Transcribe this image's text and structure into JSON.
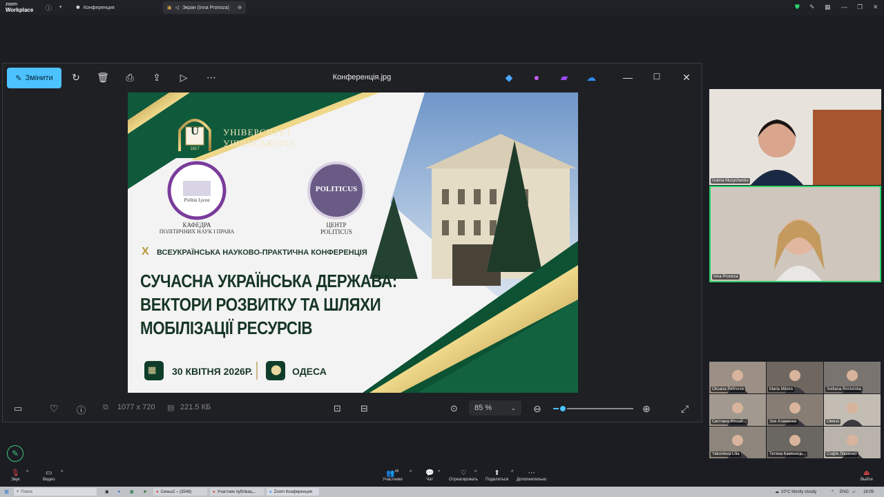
{
  "zoom": {
    "logo_line1": "zoom",
    "logo_line2": "Workplace",
    "tabs": [
      {
        "label": "Конференция"
      },
      {
        "label": "Экран (Inna Pronoza)"
      }
    ]
  },
  "photos": {
    "edit_label": "Змінити",
    "file_name": "Конференція.jpg",
    "dimensions": "1077 x 720",
    "file_size": "221.5 КБ",
    "zoom_level": "85 %",
    "zoom_fraction": 0.12
  },
  "slide": {
    "university_line1": "УНІВЕРСИТЕТ",
    "university_line2": "УШИНСЬКОГО",
    "logo_year": "1817",
    "logo_letter": "U",
    "dept_line1": "КАФЕДРА",
    "dept_line2": "ПОЛІТИЧНИХ НАУК І ПРАВА",
    "dept_logo_text": "Politia Lycea",
    "center_logo_text": "POLITICUS",
    "center_line1": "ЦЕНТР",
    "center_line2": "POLITICUS",
    "conf_number": "X",
    "conf_subtitle": "ВСЕУКРАЇНСЬКА НАУКОВО-ПРАКТИЧНА КОНФЕРЕНЦІЯ",
    "title_line1": "СУЧАСНА УКРАЇНСЬКА ДЕРЖАВА:",
    "title_line2": "ВЕКТОРИ РОЗВИТКУ ТА ШЛЯХИ",
    "title_line3": "МОБІЛІЗАЦІЇ РЕСУРСІВ",
    "date": "30 КВІТНЯ 2026Р.",
    "city": "ОДЕСА"
  },
  "participants_large": [
    {
      "name": "Galina Muzychenko"
    },
    {
      "name": "Inna Pronoza"
    }
  ],
  "participants_small": [
    {
      "name": "Oksana Petinova"
    },
    {
      "name": "Maria Milova"
    },
    {
      "name": "Svitlana Rostetska"
    },
    {
      "name": "Світлана Михай..."
    },
    {
      "name": "Зоя Атаманюк"
    },
    {
      "name": "Oleksii"
    },
    {
      "name": "Yakovleva Lilia"
    },
    {
      "name": "Тетяна Каменець..."
    },
    {
      "name": "Софія Ляшенко"
    }
  ],
  "zoom_bar": {
    "audio": "Звук",
    "video": "Видео",
    "participants": "Участники",
    "participants_count": "49",
    "chat": "Чат",
    "react": "Отреагировать",
    "share": "Поделиться",
    "more": "Дополнительно",
    "leave": "Выйти"
  },
  "taskbar": {
    "search_placeholder": "Поиск",
    "apps": [
      {
        "label": "Сеньо2 – (3548)"
      },
      {
        "label": "Участник публікац..."
      },
      {
        "label": "Zoom Конференция"
      }
    ],
    "weather": "10°C  Mostly cloudy",
    "lang": "ENG",
    "time": "18:09"
  }
}
